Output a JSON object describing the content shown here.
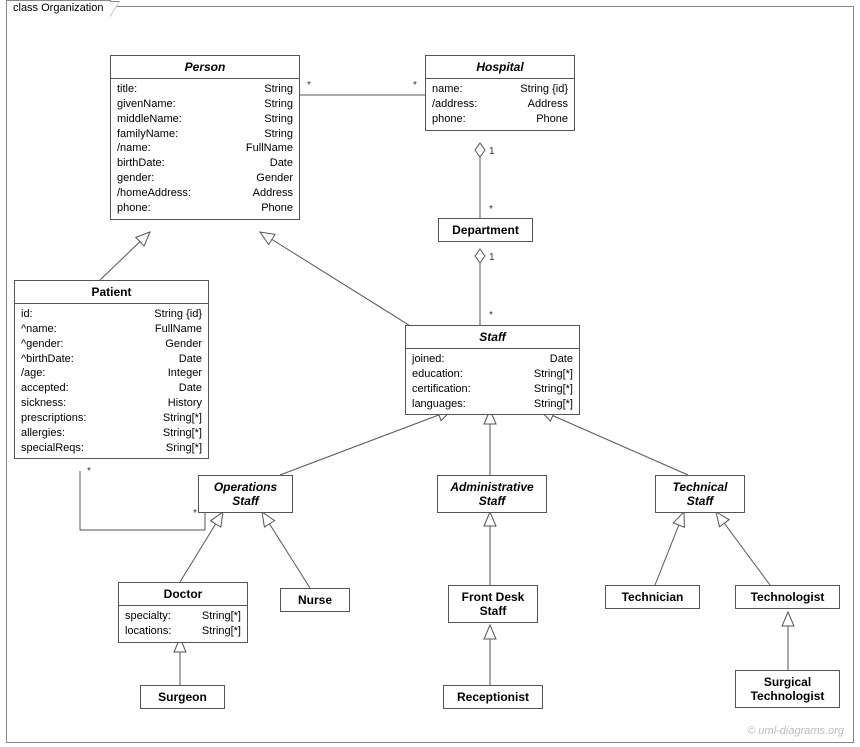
{
  "frame": {
    "title": "class Organization"
  },
  "classes": {
    "person": {
      "name": "Person",
      "abstract": true,
      "attrs": [
        {
          "n": "title:",
          "t": "String"
        },
        {
          "n": "givenName:",
          "t": "String"
        },
        {
          "n": "middleName:",
          "t": "String"
        },
        {
          "n": "familyName:",
          "t": "String"
        },
        {
          "n": "/name:",
          "t": "FullName"
        },
        {
          "n": "birthDate:",
          "t": "Date"
        },
        {
          "n": "gender:",
          "t": "Gender"
        },
        {
          "n": "/homeAddress:",
          "t": "Address"
        },
        {
          "n": "phone:",
          "t": "Phone"
        }
      ]
    },
    "hospital": {
      "name": "Hospital",
      "abstract": true,
      "attrs": [
        {
          "n": "name:",
          "t": "String {id}"
        },
        {
          "n": "/address:",
          "t": "Address"
        },
        {
          "n": "phone:",
          "t": "Phone"
        }
      ]
    },
    "department": {
      "name": "Department",
      "abstract": false,
      "attrs": []
    },
    "patient": {
      "name": "Patient",
      "abstract": false,
      "attrs": [
        {
          "n": "id:",
          "t": "String {id}"
        },
        {
          "n": "^name:",
          "t": "FullName"
        },
        {
          "n": "^gender:",
          "t": "Gender"
        },
        {
          "n": "^birthDate:",
          "t": "Date"
        },
        {
          "n": "/age:",
          "t": "Integer"
        },
        {
          "n": "accepted:",
          "t": "Date"
        },
        {
          "n": "sickness:",
          "t": "History"
        },
        {
          "n": "prescriptions:",
          "t": "String[*]"
        },
        {
          "n": "allergies:",
          "t": "String[*]"
        },
        {
          "n": "specialReqs:",
          "t": "Sring[*]"
        }
      ]
    },
    "staff": {
      "name": "Staff",
      "abstract": true,
      "attrs": [
        {
          "n": "joined:",
          "t": "Date"
        },
        {
          "n": "education:",
          "t": "String[*]"
        },
        {
          "n": "certification:",
          "t": "String[*]"
        },
        {
          "n": "languages:",
          "t": "String[*]"
        }
      ]
    },
    "operations": {
      "name": "Operations\nStaff",
      "abstract": true,
      "attrs": []
    },
    "administrative": {
      "name": "Administrative\nStaff",
      "abstract": true,
      "attrs": []
    },
    "technical": {
      "name": "Technical\nStaff",
      "abstract": true,
      "attrs": []
    },
    "doctor": {
      "name": "Doctor",
      "abstract": false,
      "attrs": [
        {
          "n": "specialty:",
          "t": "String[*]"
        },
        {
          "n": "locations:",
          "t": "String[*]"
        }
      ]
    },
    "nurse": {
      "name": "Nurse",
      "abstract": false,
      "attrs": []
    },
    "frontdesk": {
      "name": "Front Desk\nStaff",
      "abstract": false,
      "attrs": []
    },
    "receptionist": {
      "name": "Receptionist",
      "abstract": false,
      "attrs": []
    },
    "technician": {
      "name": "Technician",
      "abstract": false,
      "attrs": []
    },
    "technologist": {
      "name": "Technologist",
      "abstract": false,
      "attrs": []
    },
    "surgtech": {
      "name": "Surgical\nTechnologist",
      "abstract": false,
      "attrs": []
    },
    "surgeon": {
      "name": "Surgeon",
      "abstract": false,
      "attrs": []
    }
  },
  "mult": {
    "person_hospital_l": "*",
    "person_hospital_r": "*",
    "hosp_dept_top": "1",
    "hosp_dept_bot": "*",
    "dept_staff_top": "1",
    "dept_staff_bot": "*",
    "patient_ops_p": "*",
    "patient_ops_o": "*"
  },
  "watermark": "© uml-diagrams.org"
}
